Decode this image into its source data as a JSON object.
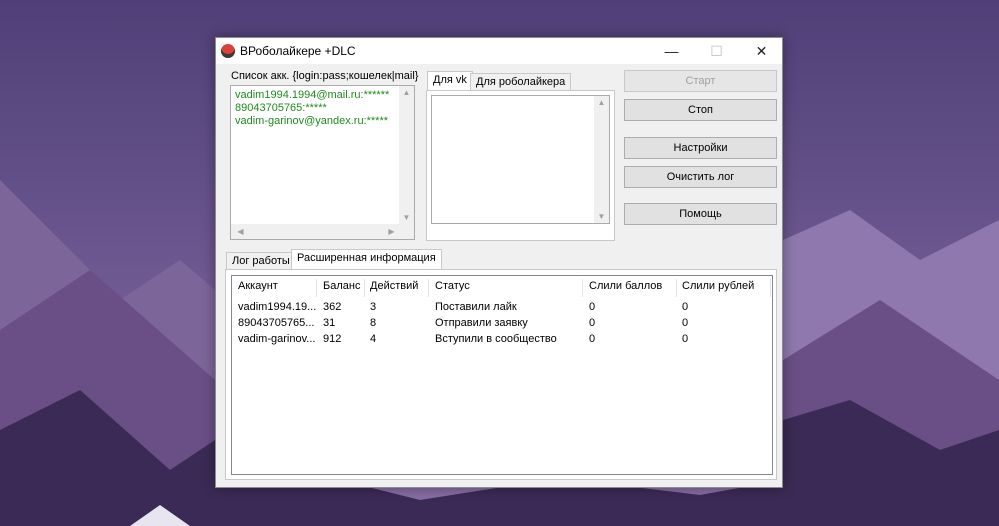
{
  "window": {
    "title": "ВРоболайкере +DLC",
    "controls": {
      "minimize": "—",
      "maximize": "☐",
      "close": "✕"
    }
  },
  "accounts_panel": {
    "label": "Список акк. {login:pass;кошелек|mail}",
    "lines": [
      "vadim1994.1994@mail.ru:******",
      "89043705765:*****",
      "vadim-garinov@yandex.ru:*****"
    ]
  },
  "top_tabs": [
    {
      "label": "Для vk",
      "active": true
    },
    {
      "label": "Для роболайкера",
      "active": false
    }
  ],
  "buttons": {
    "start": "Старт",
    "stop": "Стоп",
    "settings": "Настройки",
    "clear_log": "Очистить лог",
    "help": "Помощь"
  },
  "bottom_tabs": [
    {
      "label": "Лог работы",
      "active": false
    },
    {
      "label": "Расширенная информация",
      "active": true
    }
  ],
  "table": {
    "columns": [
      "Аккаунт",
      "Баланс",
      "Действий",
      "Статус",
      "Слили баллов",
      "Слили рублей"
    ],
    "rows": [
      [
        "vadim1994.19...",
        "362",
        "3",
        "Поставили лайк",
        "0",
        "0"
      ],
      [
        "89043705765...",
        "31",
        "8",
        "Отправили заявку",
        "0",
        "0"
      ],
      [
        "vadim-garinov...",
        "912",
        "4",
        "Вступили в сообщество",
        "0",
        "0"
      ]
    ]
  },
  "colors": {
    "account_text": "#1e8a1e",
    "window_bg": "#f0f0f0",
    "desktop_bg": "#6f5a94"
  }
}
